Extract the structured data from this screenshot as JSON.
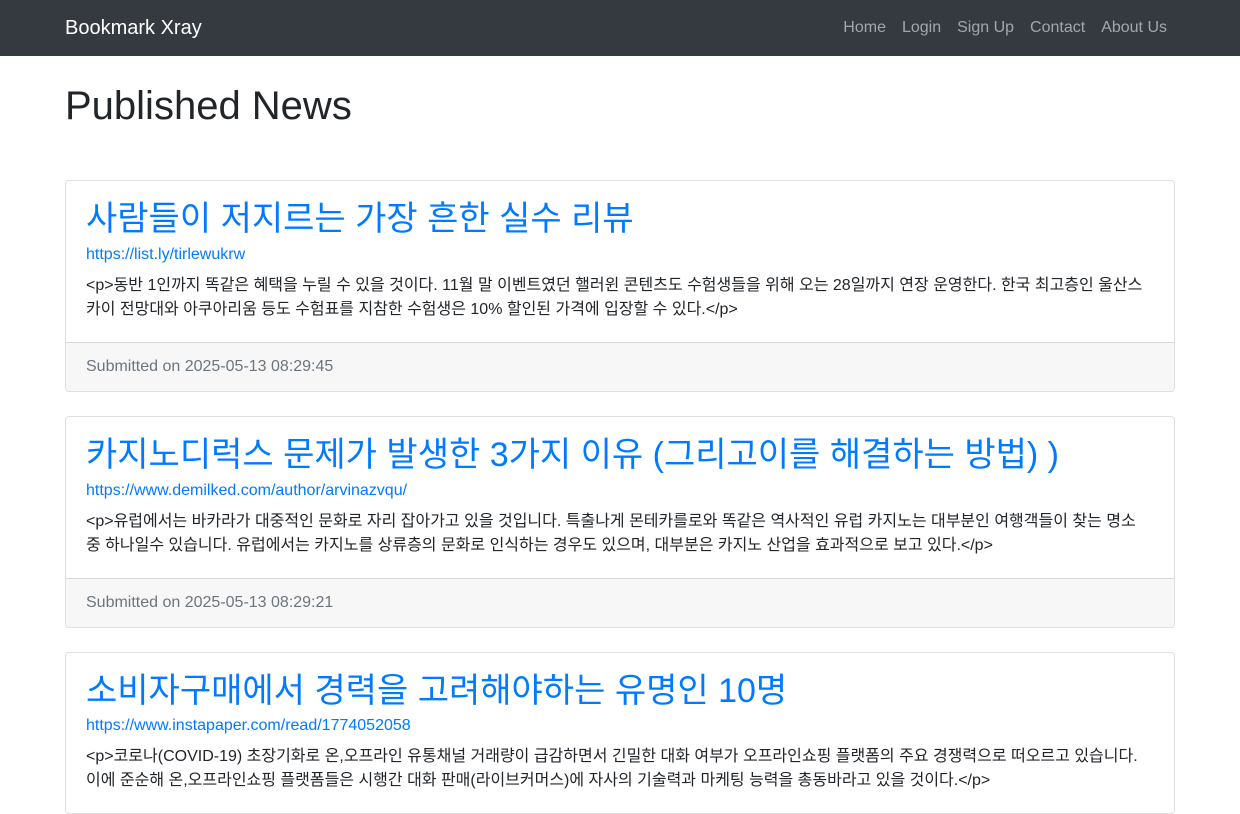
{
  "navbar": {
    "brand": "Bookmark Xray",
    "links": [
      "Home",
      "Login",
      "Sign Up",
      "Contact",
      "About Us"
    ]
  },
  "page": {
    "title": "Published News"
  },
  "articles": [
    {
      "title": "사람들이 저지르는 가장 흔한 실수 리뷰",
      "url": "https://list.ly/tirlewukrw",
      "excerpt": "<p>동반 1인까지 똑같은 혜택을 누릴 수 있을 것이다. 11월 말 이벤트였던 핼러윈 콘텐츠도 수험생들을 위해 오는 28일까지 연장 운영한다. 한국 최고층인 울산스카이 전망대와 아쿠아리움 등도 수험표를 지참한 수험생은 10% 할인된 가격에 입장할 수 있다.</p>",
      "submitted": "Submitted on 2025-05-13 08:29:45"
    },
    {
      "title": "카지노디럭스 문제가 발생한 3가지 이유 (그리고이를 해결하는 방법) )",
      "url": "https://www.demilked.com/author/arvinazvqu/",
      "excerpt": "<p>유럽에서는 바카라가 대중적인 문화로 자리 잡아가고 있을 것입니다. 특출나게 몬테카를로와 똑같은 역사적인 유럽 카지노는 대부분인 여행객들이 찾는 명소 중 하나일수 있습니다. 유럽에서는 카지노를 상류층의 문화로 인식하는 경우도 있으며, 대부분은 카지노 산업을 효과적으로 보고 있다.</p>",
      "submitted": "Submitted on 2025-05-13 08:29:21"
    },
    {
      "title": "소비자구매에서 경력을 고려해야하는 유명인 10명",
      "url": "https://www.instapaper.com/read/1774052058",
      "excerpt": "<p>코로나(COVID-19) 초장기화로 온,오프라인 유통채널 거래량이 급감하면서 긴밀한 대화 여부가 오프라인쇼핑 플랫폼의 주요 경쟁력으로 떠오르고 있습니다. 이에 준순해 온,오프라인쇼핑 플랫폼들은 시행간 대화 판매(라이브커머스)에 자사의 기술력과 마케팅 능력을 총동바라고 있을 것이다.</p>",
      "submitted": ""
    }
  ]
}
